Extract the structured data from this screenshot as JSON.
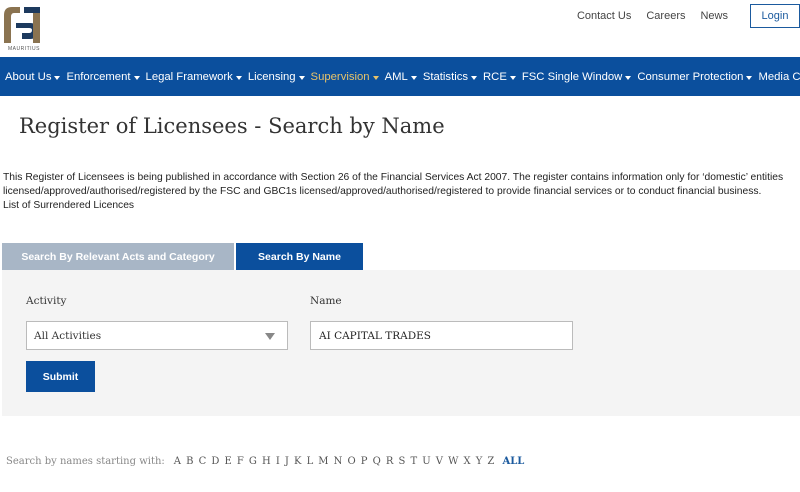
{
  "header": {
    "logo_text": "MAURITIUS",
    "links": [
      "Contact Us",
      "Careers",
      "News"
    ],
    "login_label": "Login"
  },
  "nav": {
    "items": [
      {
        "label": "About Us",
        "active": false
      },
      {
        "label": "Enforcement",
        "active": false
      },
      {
        "label": "Legal Framework",
        "active": false
      },
      {
        "label": "Licensing",
        "active": false
      },
      {
        "label": "Supervision",
        "active": true
      },
      {
        "label": "AML",
        "active": false
      },
      {
        "label": "Statistics",
        "active": false
      },
      {
        "label": "RCE",
        "active": false
      },
      {
        "label": "FSC Single Window",
        "active": false
      },
      {
        "label": "Consumer Protection",
        "active": false
      },
      {
        "label": "Media Corner",
        "active": false
      }
    ]
  },
  "page": {
    "title": "Register of Licensees - Search by Name",
    "intro_line1": "This Register of Licensees is being published in accordance with Section 26 of the Financial Services Act 2007. The register contains information only for ‘domestic’ entities",
    "intro_line2": "licensed/approved/authorised/registered by the FSC and GBC1s licensed/approved/authorised/registered to provide financial services or to conduct financial business.",
    "intro_line3": "List of Surrendered Licences"
  },
  "tabs": {
    "acts": "Search By Relevant Acts and Category",
    "name": "Search By Name"
  },
  "form": {
    "activity_label": "Activity",
    "activity_value": "All Activities",
    "name_label": "Name",
    "name_value": "AI CAPITAL TRADES",
    "submit_label": "Submit"
  },
  "alphabet": {
    "label": "Search by names starting with:",
    "letters": [
      "A",
      "B",
      "C",
      "D",
      "E",
      "F",
      "G",
      "H",
      "I",
      "J",
      "K",
      "L",
      "M",
      "N",
      "O",
      "P",
      "Q",
      "R",
      "S",
      "T",
      "U",
      "V",
      "W",
      "X",
      "Y",
      "Z"
    ],
    "all_label": "ALL"
  },
  "colors": {
    "nav_bg": "#0b4f9d",
    "active_nav": "#e7c36a",
    "tab_inactive": "#a8b6c6",
    "panel_bg": "#f4f4f4"
  }
}
